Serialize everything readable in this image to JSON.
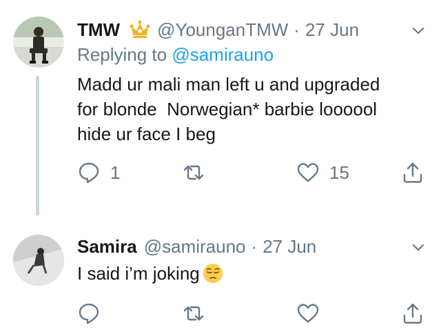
{
  "tweets": [
    {
      "name": "TMW",
      "verified_icon": "crown-icon",
      "handle": "@YounganTMW",
      "separator": "·",
      "date": "27 Jun",
      "replying_prefix": "Replying to ",
      "replying_to": "@samirauno",
      "text_lines": [
        "Madd ur mali man left u and upgraded",
        "for blonde  Norwegian* barbie loooool",
        "hide ur face I beg"
      ],
      "reply_count": "1",
      "retweet_count": "",
      "like_count": "15"
    },
    {
      "name": "Samira",
      "handle": "@samirauno",
      "separator": "·",
      "date": "27 Jun",
      "text": "I said i’m joking",
      "emoji": "pensive-face-emoji",
      "reply_count": "",
      "retweet_count": "",
      "like_count": ""
    }
  ],
  "colors": {
    "text_primary": "#14171a",
    "text_secondary": "#657786",
    "link_blue": "#1da1f2",
    "thread_line": "#ccd6dd",
    "crown_gold": "#f0b429"
  },
  "icons": {
    "reply": "reply-icon",
    "retweet": "retweet-icon",
    "like": "heart-icon",
    "share": "share-icon",
    "menu": "chevron-down-icon"
  }
}
